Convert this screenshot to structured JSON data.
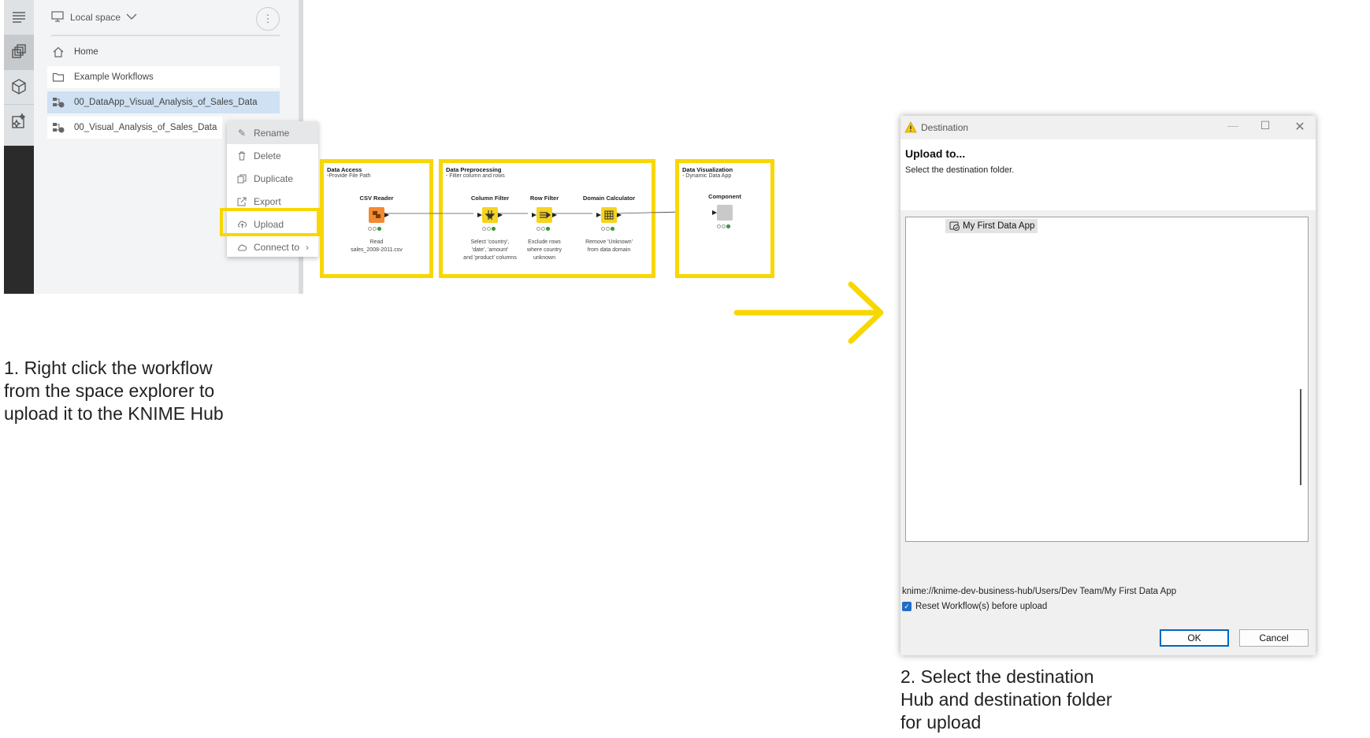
{
  "explorer": {
    "space_label": "Local space",
    "home": "Home",
    "items": [
      {
        "label": "Example Workflows"
      },
      {
        "label": "00_DataApp_Visual_Analysis_of_Sales_Data"
      },
      {
        "label": "00_Visual_Analysis_of_Sales_Data"
      }
    ]
  },
  "context_menu": {
    "items": [
      {
        "label": "Rename"
      },
      {
        "label": "Delete"
      },
      {
        "label": "Duplicate"
      },
      {
        "label": "Export"
      },
      {
        "label": "Upload"
      },
      {
        "label": "Connect to"
      }
    ]
  },
  "workflow": {
    "data_access": {
      "title": "Data Access",
      "subtitle": "-Provide File Path",
      "node_name": "CSV Reader",
      "node_desc_1": "Read",
      "node_desc_2": "sales_2008-2011.csv"
    },
    "preprocessing": {
      "title": "Data Preprocessing",
      "subtitle": "- Filter column and rows",
      "nodes": [
        {
          "name": "Column Filter",
          "desc": [
            "Select 'country',",
            "'date', 'amount'",
            "and 'product' columns"
          ]
        },
        {
          "name": "Row Filter",
          "desc": [
            "Exclude rows",
            "where country",
            "unknown"
          ]
        },
        {
          "name": "Domain Calculator",
          "desc": [
            "Remove 'Unknown'",
            "from data domain"
          ]
        }
      ]
    },
    "visualization": {
      "title": "Data Visualization",
      "subtitle": "- Dynamic Data App",
      "node_name": "Component"
    }
  },
  "instructions": {
    "step1": [
      "1. Right click the workflow",
      "from the space explorer to",
      "upload it to the KNIME Hub"
    ],
    "step2": [
      "2. Select the destination",
      "Hub and destination folder",
      "for upload"
    ]
  },
  "dialog": {
    "title": "Destination",
    "heading": "Upload to...",
    "subheading": "Select the destination folder.",
    "tree_item": "My First Data App",
    "url": "knime://knime-dev-business-hub/Users/Dev Team/My First Data App",
    "checkbox_label": "Reset Workflow(s) before upload",
    "checkbox_checked": true,
    "ok_label": "OK",
    "cancel_label": "Cancel"
  },
  "colors": {
    "highlight": "#f8d700",
    "arrow": "#f8d700",
    "selected_row": "#cfe1f3",
    "node_orange": "#f28a33",
    "node_yellow": "#f6d41f"
  }
}
